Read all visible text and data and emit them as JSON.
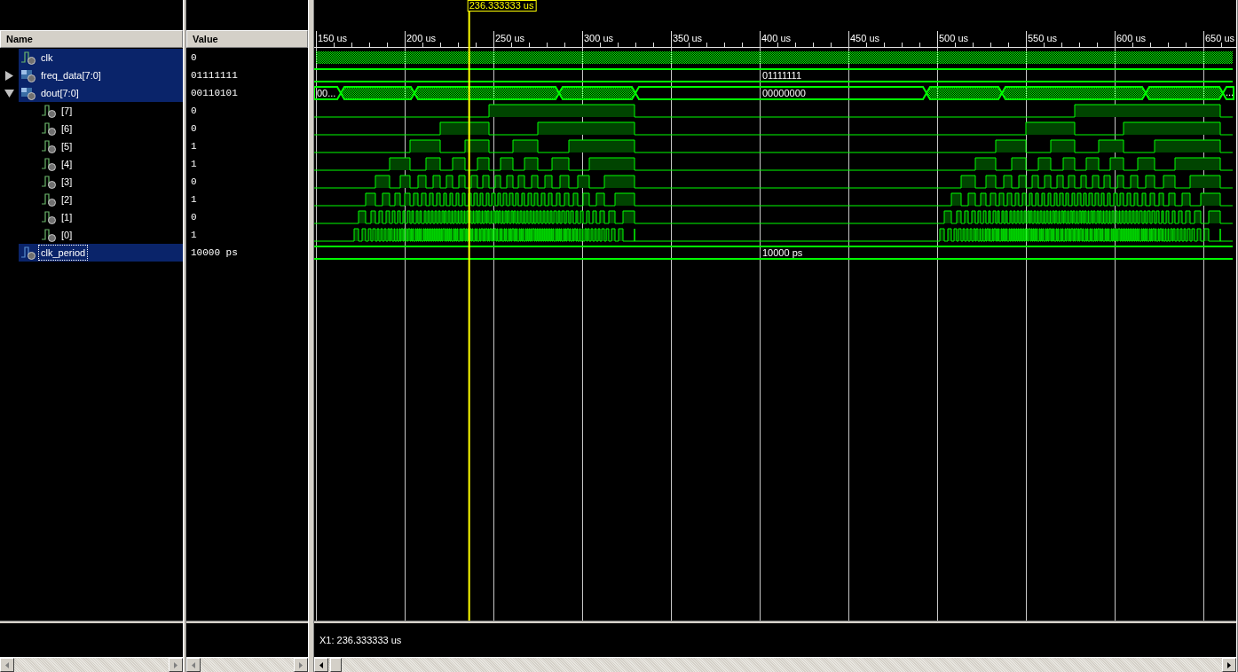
{
  "cursor": {
    "label": "236.333333 us"
  },
  "columns": {
    "name": "Name",
    "value": "Value"
  },
  "signals": [
    {
      "name": "clk",
      "kind": "bit",
      "value": "0",
      "selected": true,
      "focused": false
    },
    {
      "name": "freq_data[7:0]",
      "kind": "bus",
      "value": "01111111",
      "selected": true,
      "focused": false,
      "expanded": false,
      "wave_labels": [
        "01111111"
      ]
    },
    {
      "name": "dout[7:0]",
      "kind": "bus",
      "value": "00110101",
      "selected": true,
      "focused": false,
      "expanded": true,
      "wave_labels": [
        "00...",
        "00000000",
        "..."
      ],
      "children": [
        {
          "name": "[7]",
          "value": "0",
          "selected": false
        },
        {
          "name": "[6]",
          "value": "0",
          "selected": false
        },
        {
          "name": "[5]",
          "value": "1",
          "selected": false
        },
        {
          "name": "[4]",
          "value": "1",
          "selected": false
        },
        {
          "name": "[3]",
          "value": "0",
          "selected": false
        },
        {
          "name": "[2]",
          "value": "1",
          "selected": false
        },
        {
          "name": "[1]",
          "value": "0",
          "selected": false
        },
        {
          "name": "[0]",
          "value": "1",
          "selected": false
        }
      ]
    },
    {
      "name": "clk_period",
      "kind": "const",
      "value": "10000 ps",
      "selected": true,
      "focused": true,
      "wave_labels": [
        "10000 ps"
      ]
    }
  ],
  "ruler": [
    "150 us",
    "200 us",
    "250 us",
    "300 us",
    "350 us",
    "400 us",
    "450 us",
    "500 us",
    "550 us",
    "600 us",
    "650 us"
  ],
  "status": "X1: 236.333333 us"
}
